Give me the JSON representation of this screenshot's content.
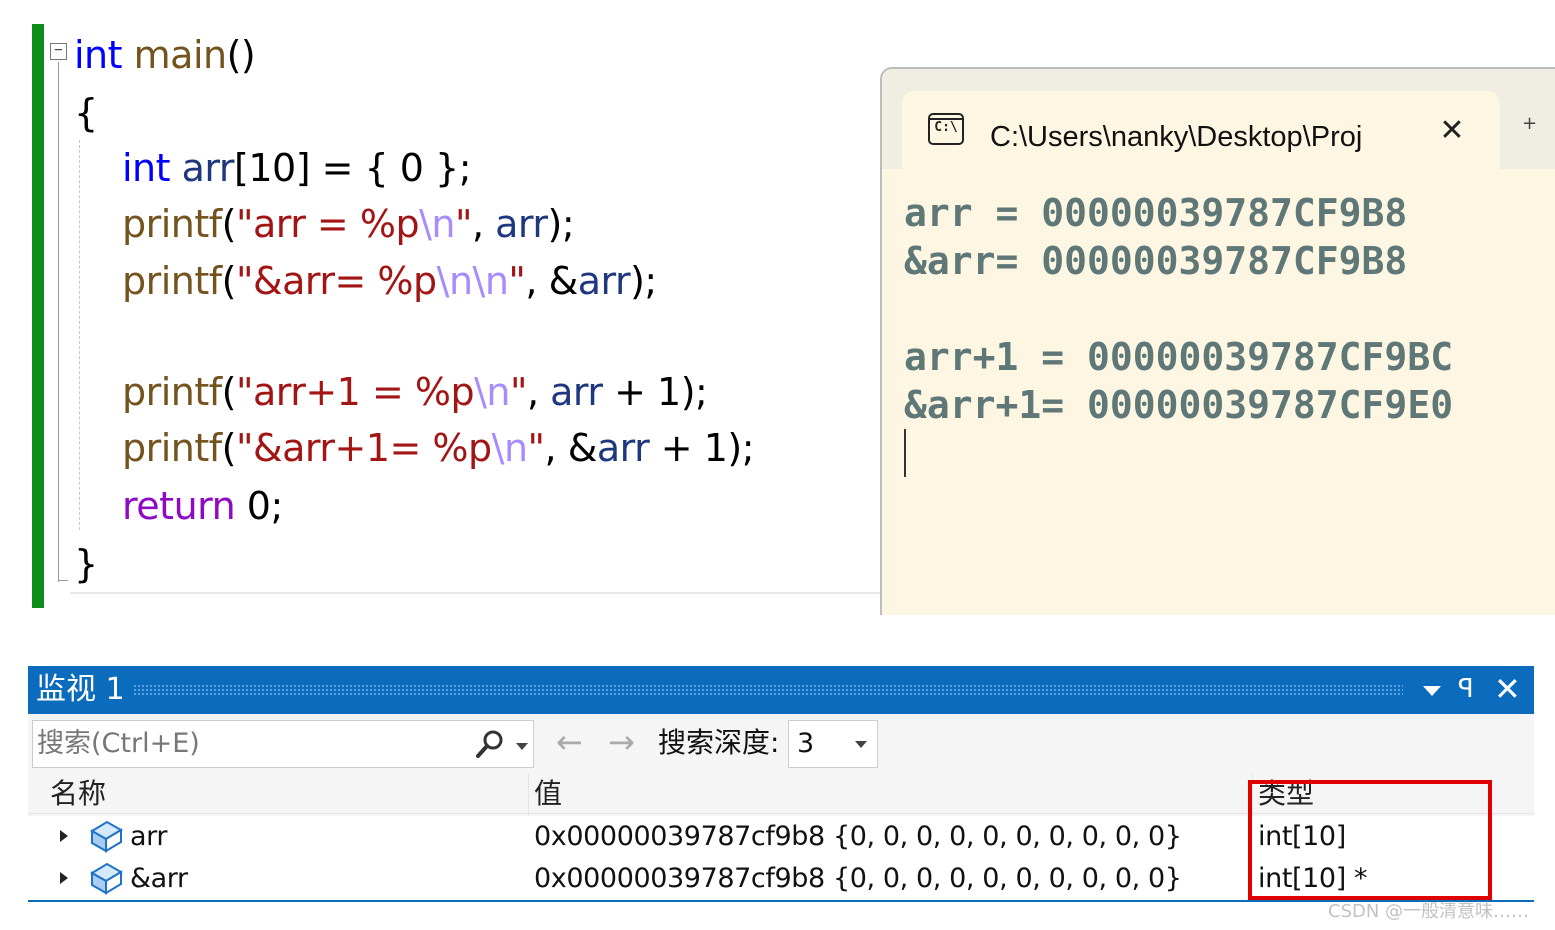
{
  "editor": {
    "fold_glyph": "−",
    "code": {
      "line1": {
        "kw": "int",
        "fn": "main",
        "rest": "()"
      },
      "line2": "{",
      "line3": {
        "kw": "int",
        "var": "arr",
        "rest": "[10] = { 0 };"
      },
      "line4": {
        "fn": "printf",
        "p1": "(",
        "s1": "\"arr = ",
        "fmt": "%p",
        "esc": "\\n",
        "s2": "\"",
        "p2": ", ",
        "var": "arr",
        "p3": ");"
      },
      "line5": {
        "fn": "printf",
        "p1": "(",
        "s1": "\"&arr= ",
        "fmt": "%p",
        "esc": "\\n\\n",
        "s2": "\"",
        "p2": ", &",
        "var": "arr",
        "p3": ");"
      },
      "line6": {
        "fn": "printf",
        "p1": "(",
        "s1": "\"arr+1 = ",
        "fmt": "%p",
        "esc": "\\n",
        "s2": "\"",
        "p2": ", ",
        "var": "arr",
        "p3": " + 1);"
      },
      "line7": {
        "fn": "printf",
        "p1": "(",
        "s1": "\"&arr+1= ",
        "fmt": "%p",
        "esc": "\\n",
        "s2": "\"",
        "p2": ", &",
        "var": "arr",
        "p3": " + 1);"
      },
      "line8": {
        "kw": "return",
        "rest": " 0;"
      },
      "line9": "}"
    }
  },
  "console": {
    "icon_label": "C:\\",
    "path": "C:\\Users\\nanky\\Desktop\\Proj",
    "close_glyph": "✕",
    "extra_glyph": "+",
    "output": [
      "arr = 00000039787CF9B8",
      "&arr= 00000039787CF9B8",
      "",
      "arr+1 = 00000039787CF9BC",
      "&arr+1= 00000039787CF9E0"
    ]
  },
  "watch": {
    "title": "监视 1",
    "pin_glyph": "ꟼ",
    "close_glyph": "✕",
    "search_placeholder": "搜索(Ctrl+E)",
    "back_glyph": "←",
    "forward_glyph": "→",
    "depth_label": "搜索深度:",
    "depth_value": "3",
    "columns": {
      "name": "名称",
      "value": "值",
      "type": "类型"
    },
    "rows": [
      {
        "name": "arr",
        "value": "0x00000039787cf9b8 {0, 0, 0, 0, 0, 0, 0, 0, 0, 0}",
        "type": "int[10]"
      },
      {
        "name": "&arr",
        "value": "0x00000039787cf9b8 {0, 0, 0, 0, 0, 0, 0, 0, 0, 0}",
        "type": "int[10] *"
      }
    ]
  },
  "colors": {
    "accent": "#0b6bbd",
    "highlight": "#e00000",
    "change_bar": "#108c18",
    "console_bg": "#fcf6e2"
  },
  "watermark": "CSDN @一般清意味……"
}
